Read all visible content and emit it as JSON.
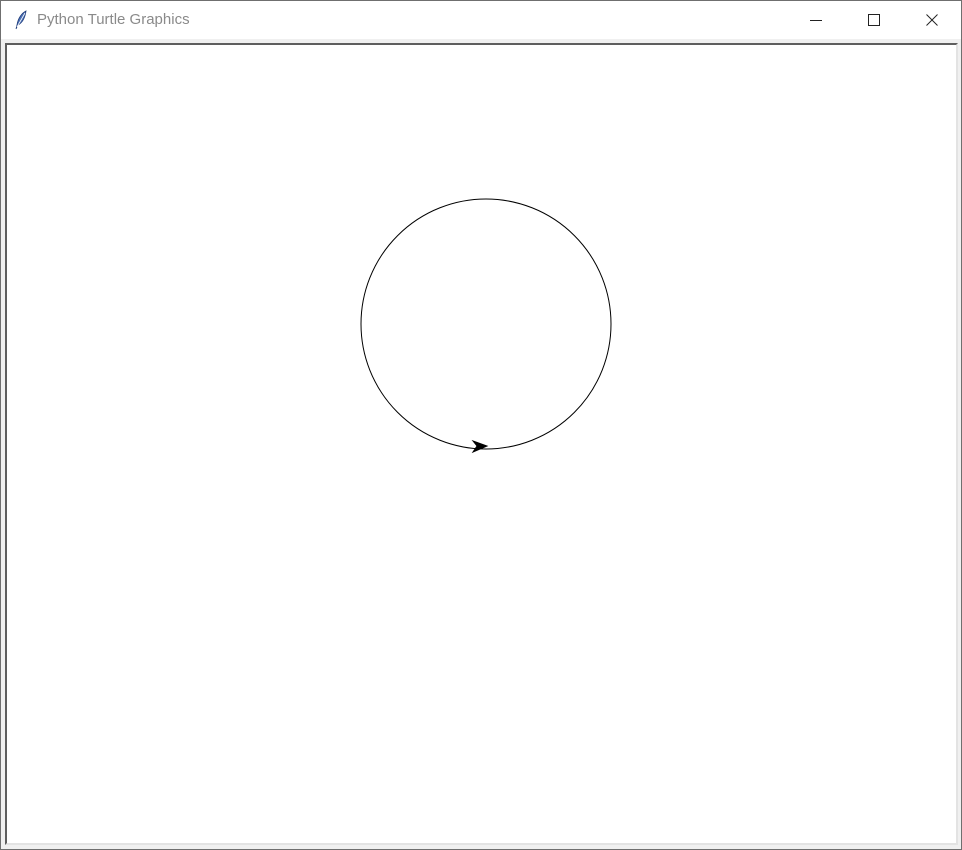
{
  "window": {
    "title": "Python Turtle Graphics",
    "icon": "feather-icon"
  },
  "controls": {
    "minimize_icon": "minimize-icon",
    "maximize_icon": "maximize-icon",
    "close_icon": "close-icon"
  },
  "canvas": {
    "background": "#ffffff",
    "pen_color": "#000000",
    "drawing": "circle",
    "turtle_shape": "arrow",
    "turtle_heading": "east"
  }
}
